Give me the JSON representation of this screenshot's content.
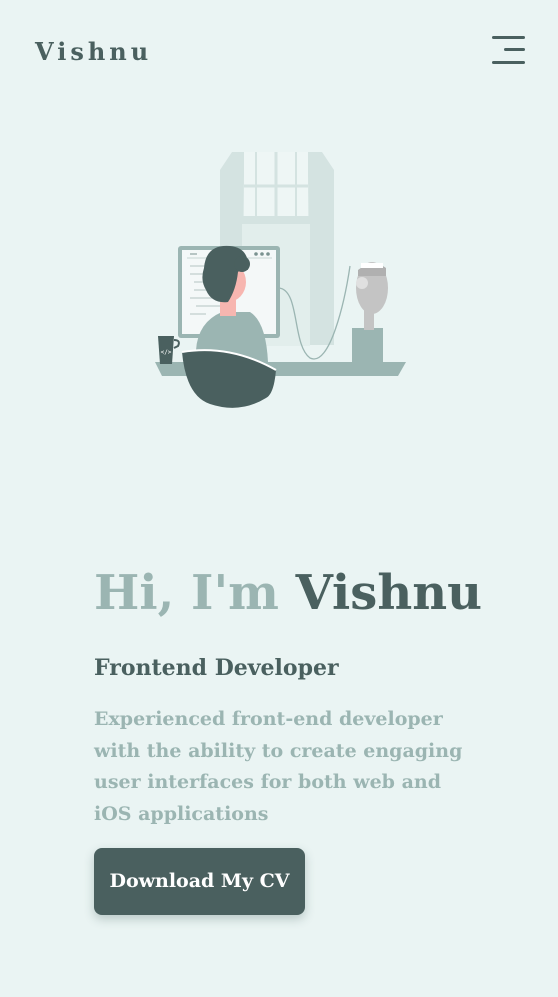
{
  "colors": {
    "background": "#eaf4f3",
    "primary": "#4a605f",
    "muted": "#9bb5b2",
    "button_text": "#ffffff"
  },
  "header": {
    "brand": "Vishnu",
    "menu_icon": "hamburger-menu-icon"
  },
  "hero": {
    "illustration": "developer-at-computer-illustration",
    "greeting_prefix": "Hi, I'm ",
    "greeting_name": "Vishnu",
    "role": "Frontend Developer",
    "bio": "Experienced front-end developer with the ability to create engaging user interfaces for both web and iOS applications",
    "cta_label": "Download My CV"
  }
}
